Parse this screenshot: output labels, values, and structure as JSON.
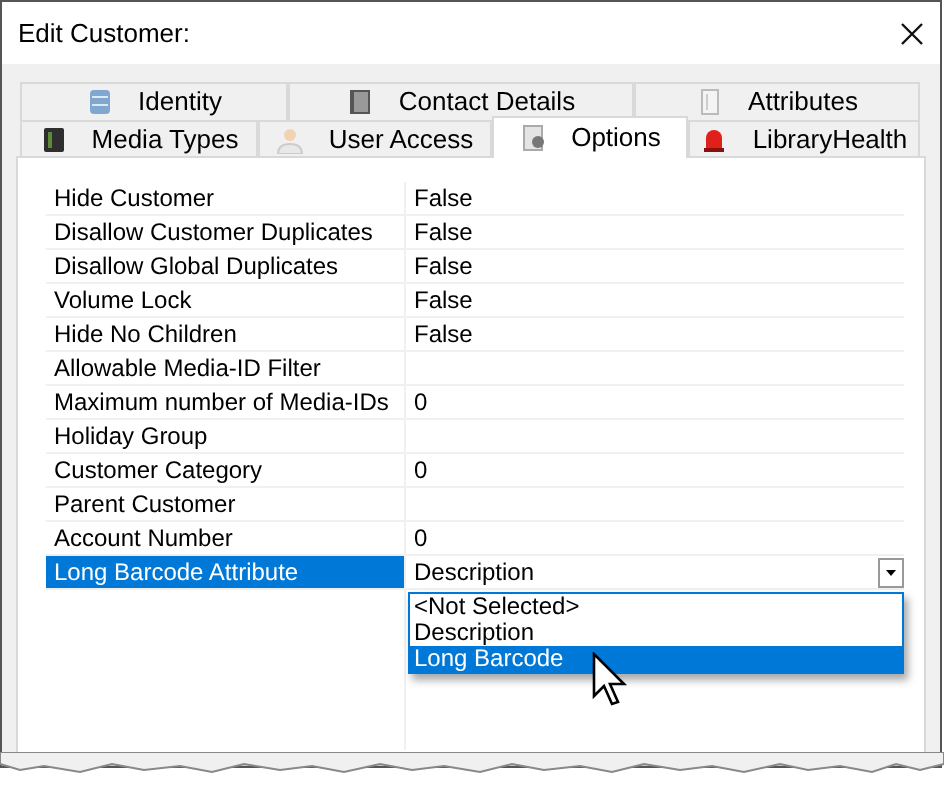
{
  "window": {
    "title": "Edit Customer:"
  },
  "tab_rows": [
    [
      {
        "label": "Identity",
        "selected": false
      },
      {
        "label": "Contact Details",
        "selected": false
      },
      {
        "label": "Attributes",
        "selected": false
      }
    ],
    [
      {
        "label": "Media Types",
        "selected": false
      },
      {
        "label": "User Access",
        "selected": false
      },
      {
        "label": "Options",
        "selected": true
      },
      {
        "label": "LibraryHealth",
        "selected": false
      }
    ]
  ],
  "properties": [
    {
      "name": "Hide Customer",
      "value": "False",
      "selected": false,
      "kind": "text"
    },
    {
      "name": "Disallow Customer Duplicates",
      "value": "False",
      "selected": false,
      "kind": "text"
    },
    {
      "name": "Disallow Global Duplicates",
      "value": "False",
      "selected": false,
      "kind": "text"
    },
    {
      "name": "Volume Lock",
      "value": "False",
      "selected": false,
      "kind": "text"
    },
    {
      "name": "Hide No Children",
      "value": "False",
      "selected": false,
      "kind": "text"
    },
    {
      "name": "Allowable Media-ID Filter",
      "selected": false,
      "kind": "text"
    },
    {
      "name": "Maximum number of Media-IDs",
      "value": "0",
      "selected": false,
      "kind": "text"
    },
    {
      "name": "Holiday Group",
      "selected": false,
      "kind": "text"
    },
    {
      "name": "Customer Category",
      "value": "0",
      "selected": false,
      "kind": "text"
    },
    {
      "name": "Parent Customer",
      "selected": false,
      "kind": "text"
    },
    {
      "name": "Account Number",
      "value": "0",
      "selected": false,
      "kind": "text"
    },
    {
      "name": "Long Barcode Attribute",
      "value": "Description",
      "selected": true,
      "kind": "dropdown",
      "expanded": true,
      "options": [
        {
          "label": "<Not Selected>",
          "highlighted": false
        },
        {
          "label": "Description",
          "highlighted": false
        },
        {
          "label": "Long Barcode",
          "highlighted": true
        }
      ]
    }
  ]
}
